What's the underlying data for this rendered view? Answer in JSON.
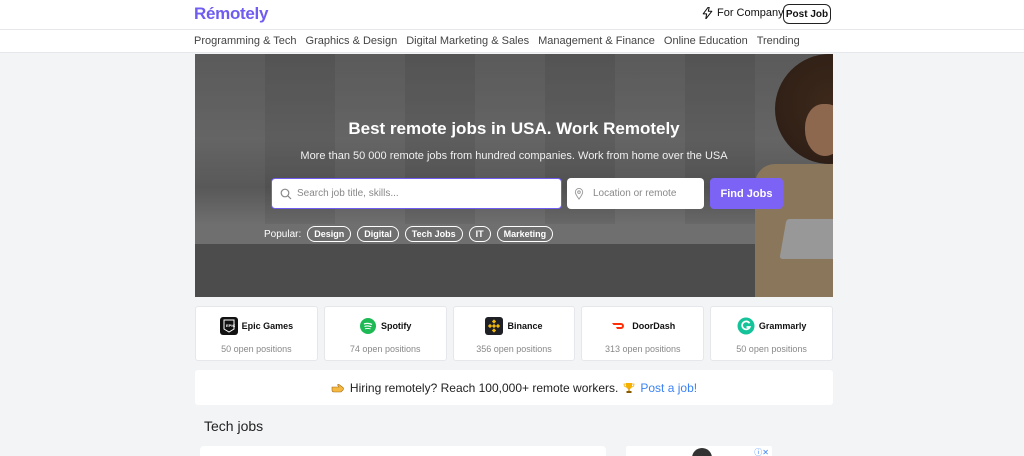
{
  "header": {
    "logo": "Rémotely",
    "for_company": "For Company",
    "post_job": "Post Job"
  },
  "categories": [
    "Programming & Tech",
    "Graphics & Design",
    "Digital Marketing & Sales",
    "Management & Finance",
    "Online Education",
    "Trending"
  ],
  "hero": {
    "title": "Best remote jobs in USA. Work Remotely",
    "subtitle": "More than 50 000 remote jobs from hundred companies. Work from home over the USA",
    "search_placeholder": "Search job title, skills...",
    "location_placeholder": "Location or remote",
    "find_button": "Find Jobs",
    "popular_label": "Popular:",
    "popular_tags": [
      "Design",
      "Digital",
      "Tech Jobs",
      "IT",
      "Marketing"
    ]
  },
  "companies": [
    {
      "name": "Epic Games",
      "positions": "50 open positions",
      "icon": "epic-games-logo",
      "color": "#111111"
    },
    {
      "name": "Spotify",
      "positions": "74 open positions",
      "icon": "spotify-logo",
      "color": "#1db954"
    },
    {
      "name": "Binance",
      "positions": "356 open positions",
      "icon": "binance-logo",
      "color": "#f0b90b"
    },
    {
      "name": "DoorDash",
      "positions": "313 open positions",
      "icon": "doordash-logo",
      "color": "#ff3008"
    },
    {
      "name": "Grammarly",
      "positions": "50 open positions",
      "icon": "grammarly-logo",
      "color": "#15c39a"
    }
  ],
  "banner": {
    "text": "Hiring remotely? Reach 100,000+ remote workers.",
    "link": "Post a job!"
  },
  "section": {
    "title": "Tech jobs"
  },
  "colors": {
    "accent": "#7c62f5",
    "link": "#3b82f6"
  }
}
